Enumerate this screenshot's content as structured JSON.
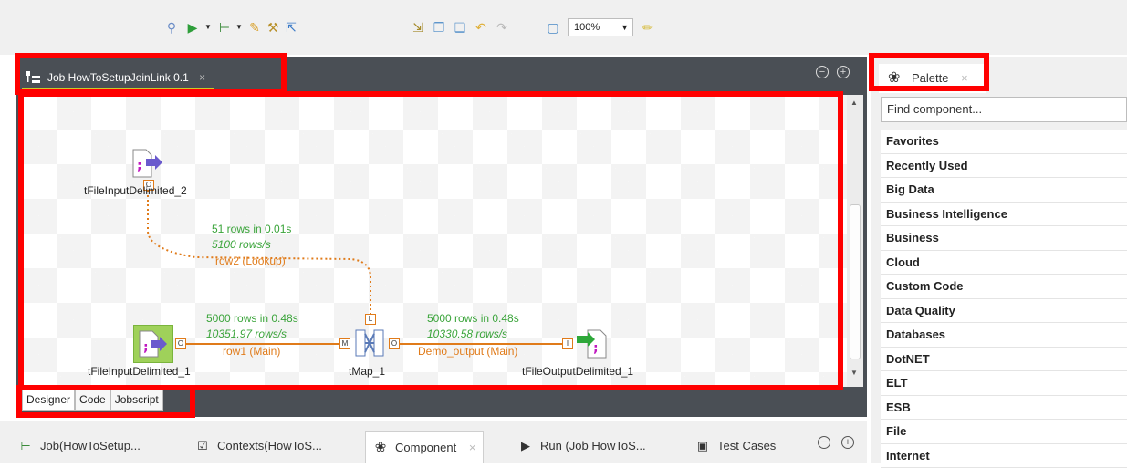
{
  "toolbar": {
    "zoom": "100%",
    "icons": [
      "search-icon",
      "run-icon",
      "dropdown-icon",
      "job-icon",
      "dropdown-icon",
      "edit-icon",
      "wrench-icon",
      "export-icon",
      "import-icon",
      "copy-icon",
      "paste-icon",
      "undo-icon",
      "redo-icon",
      "page-icon",
      "brush-icon"
    ]
  },
  "editor": {
    "tab_title": "Job HowToSetupJoinLink 0.1",
    "tab_close": "×",
    "minimize": "−",
    "maximize": "+",
    "components": {
      "input2": "tFileInputDelimited_2",
      "input1": "tFileInputDelimited_1",
      "tmap": "tMap_1",
      "output1": "tFileOutputDelimited_1"
    },
    "flows": {
      "lookup_rows": "51 rows in 0.01s",
      "lookup_rate": "5100 rows/s",
      "lookup_name": "row2 (Lookup)",
      "main_rows": "5000 rows in 0.48s",
      "main_rate": "10351.97 rows/s",
      "main_name": "row1 (Main)",
      "out_rows": "5000 rows in 0.48s",
      "out_rate": "10330.58 rows/s",
      "out_name": "Demo_output (Main)"
    },
    "view_tabs": [
      "Designer",
      "Code",
      "Jobscript"
    ]
  },
  "bottom_tabs": {
    "job": "Job(HowToSetup...",
    "contexts": "Contexts(HowToS...",
    "component": "Component",
    "run": "Run (Job HowToS...",
    "tests": "Test Cases",
    "close": "×",
    "minimize": "−",
    "maximize": "+"
  },
  "palette": {
    "title": "Palette",
    "close": "×",
    "search_placeholder": "Find component...",
    "categories": [
      "Favorites",
      "Recently Used",
      "Big Data",
      "Business Intelligence",
      "Business",
      "Cloud",
      "Custom Code",
      "Data Quality",
      "Databases",
      "DotNET",
      "ELT",
      "ESB",
      "File",
      "Internet"
    ]
  },
  "colors": {
    "highlight": "#ff0000",
    "flow_green": "#3aa43a",
    "flow_orange": "#e07b1a",
    "editor_frame": "#4a4f55"
  }
}
